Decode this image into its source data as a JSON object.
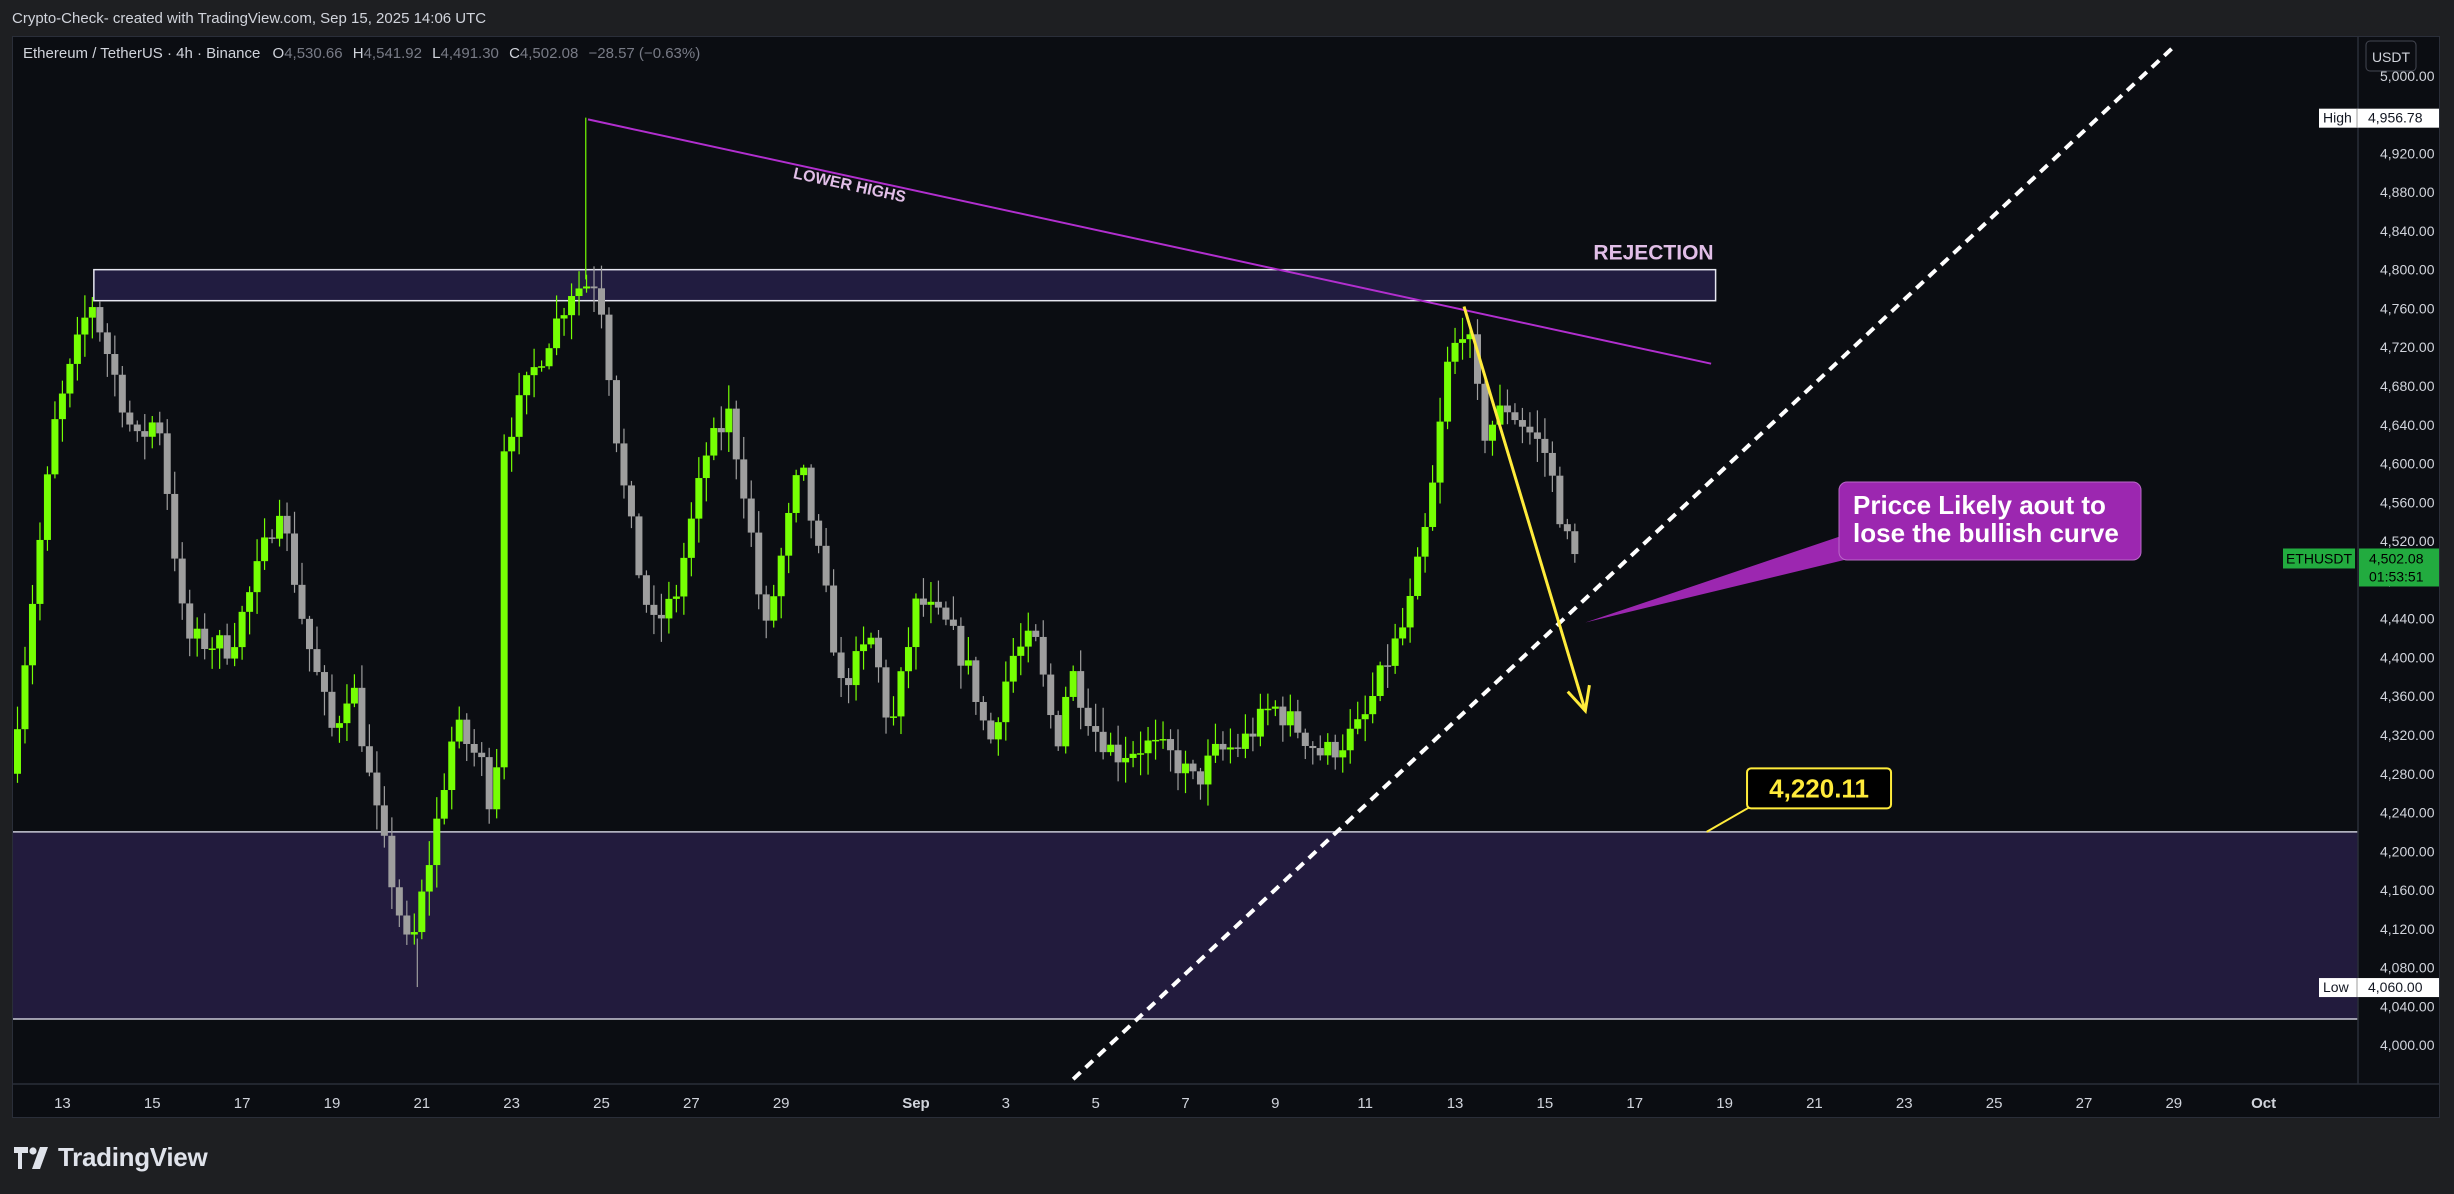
{
  "header": {
    "attribution": "Crypto-Check- created with TradingView.com, Sep 15, 2025 14:06 UTC"
  },
  "legend": {
    "symbol": "Ethereum / TetherUS · 4h · Binance",
    "open_key": "O",
    "open": "4,530.66",
    "high_key": "H",
    "high": "4,541.92",
    "low_key": "L",
    "low": "4,491.30",
    "close_key": "C",
    "close": "4,502.08",
    "change": "−28.57 (−0.63%)"
  },
  "footer": {
    "brand": "TradingView"
  },
  "chart_data": {
    "type": "candlestick",
    "currency": "USDT",
    "ylim": [
      3960,
      5040
    ],
    "y_ticks": [
      4000,
      4040,
      4080,
      4120,
      4160,
      4200,
      4240,
      4280,
      4320,
      4360,
      4400,
      4440,
      4480,
      4520,
      4560,
      4600,
      4640,
      4680,
      4720,
      4760,
      4800,
      4840,
      4880,
      4920,
      5000
    ],
    "x_ticks": [
      {
        "label": "13",
        "day": 13
      },
      {
        "label": "15",
        "day": 15
      },
      {
        "label": "17",
        "day": 17
      },
      {
        "label": "19",
        "day": 19
      },
      {
        "label": "21",
        "day": 21
      },
      {
        "label": "23",
        "day": 23
      },
      {
        "label": "25",
        "day": 25
      },
      {
        "label": "27",
        "day": 27
      },
      {
        "label": "29",
        "day": 29
      },
      {
        "label": "Sep",
        "day": 32
      },
      {
        "label": "3",
        "day": 34
      },
      {
        "label": "5",
        "day": 36
      },
      {
        "label": "7",
        "day": 38
      },
      {
        "label": "9",
        "day": 40
      },
      {
        "label": "11",
        "day": 42
      },
      {
        "label": "13",
        "day": 44
      },
      {
        "label": "15",
        "day": 46
      },
      {
        "label": "17",
        "day": 48
      },
      {
        "label": "19",
        "day": 50
      },
      {
        "label": "21",
        "day": 52
      },
      {
        "label": "23",
        "day": 54
      },
      {
        "label": "25",
        "day": 56
      },
      {
        "label": "27",
        "day": 58
      },
      {
        "label": "29",
        "day": 60
      },
      {
        "label": "Oct",
        "day": 62
      }
    ],
    "x_range_days": [
      11.9,
      64.1
    ],
    "price_path": [
      [
        12.0,
        4280
      ],
      [
        13.0,
        4640
      ],
      [
        13.8,
        4770
      ],
      [
        14.8,
        4620
      ],
      [
        15.3,
        4650
      ],
      [
        15.9,
        4420
      ],
      [
        16.9,
        4410
      ],
      [
        17.3,
        4460
      ],
      [
        18.0,
        4560
      ],
      [
        18.6,
        4420
      ],
      [
        19.2,
        4320
      ],
      [
        19.6,
        4380
      ],
      [
        20.1,
        4250
      ],
      [
        20.9,
        4090
      ],
      [
        21.5,
        4230
      ],
      [
        21.9,
        4330
      ],
      [
        22.5,
        4290
      ],
      [
        22.8,
        4230
      ],
      [
        23.0,
        4620
      ],
      [
        23.6,
        4690
      ],
      [
        24.5,
        4780
      ],
      [
        25.1,
        4790
      ],
      [
        25.6,
        4590
      ],
      [
        26.0,
        4490
      ],
      [
        26.3,
        4430
      ],
      [
        26.8,
        4460
      ],
      [
        27.5,
        4610
      ],
      [
        28.0,
        4650
      ],
      [
        28.4,
        4560
      ],
      [
        28.8,
        4420
      ],
      [
        29.6,
        4600
      ],
      [
        30.1,
        4480
      ],
      [
        30.5,
        4370
      ],
      [
        31.2,
        4420
      ],
      [
        31.6,
        4320
      ],
      [
        32.2,
        4460
      ],
      [
        32.9,
        4430
      ],
      [
        33.4,
        4380
      ],
      [
        33.8,
        4310
      ],
      [
        34.3,
        4400
      ],
      [
        34.8,
        4420
      ],
      [
        35.3,
        4310
      ],
      [
        35.6,
        4390
      ],
      [
        36.1,
        4330
      ],
      [
        36.6,
        4300
      ],
      [
        37.3,
        4310
      ],
      [
        37.8,
        4300
      ],
      [
        38.4,
        4270
      ],
      [
        38.8,
        4300
      ],
      [
        39.4,
        4310
      ],
      [
        40.1,
        4350
      ],
      [
        40.6,
        4330
      ],
      [
        41.2,
        4300
      ],
      [
        41.6,
        4310
      ],
      [
        42.1,
        4330
      ],
      [
        42.6,
        4390
      ],
      [
        43.1,
        4440
      ],
      [
        43.6,
        4550
      ],
      [
        44.0,
        4700
      ],
      [
        44.4,
        4750
      ],
      [
        44.8,
        4630
      ],
      [
        45.3,
        4660
      ],
      [
        45.7,
        4640
      ],
      [
        46.2,
        4610
      ],
      [
        46.6,
        4530
      ],
      [
        46.8,
        4502
      ]
    ],
    "high_marker": {
      "label": "High",
      "value": 4956.78,
      "value_text": "4,956.78"
    },
    "low_marker": {
      "label": "Low",
      "value": 4060.0,
      "value_text": "4,060.00"
    },
    "last_price": {
      "symbol": "ETHUSDT",
      "value": 4502.08,
      "value_text": "4,502.08",
      "countdown": "01:53:51"
    },
    "annotations": {
      "rejection_zone": {
        "label": "REJECTION",
        "x0": 13.7,
        "x1": 49.8,
        "y0": 4768,
        "y1": 4800
      },
      "demand_zone": {
        "y0": 4027,
        "y1": 4220.11
      },
      "lower_highs": {
        "label": "LOWER HIGHS",
        "x0": 24.7,
        "y0": 4955,
        "x1": 49.7,
        "y1": 4703
      },
      "bullish_curve": {
        "x0": 35.5,
        "y0": 3965,
        "x1": 60.0,
        "y1": 5030
      },
      "projection": {
        "x0": 44.2,
        "y0": 4762,
        "x1": 46.9,
        "y1": 4345
      },
      "callout": {
        "text_line1": "Pricce Likely aout to",
        "text_line2": "lose the bullish curve",
        "anchor_day": 46.9,
        "anchor_price": 4436
      },
      "level": {
        "label": "4,220.11",
        "value": 4220.11,
        "label_day": 50.5,
        "label_price": 4265
      }
    },
    "colors": {
      "up": "#76ff03",
      "down": "#9e9e9e",
      "background": "#0b0d12",
      "zone": "#221b3d",
      "trendline": "#b22fcf",
      "callout": "#9c27b0",
      "arrow": "#ffeb3b",
      "label_bg": "#000000",
      "text": "#d1d4dc",
      "last_price": "#22ab3f"
    }
  }
}
